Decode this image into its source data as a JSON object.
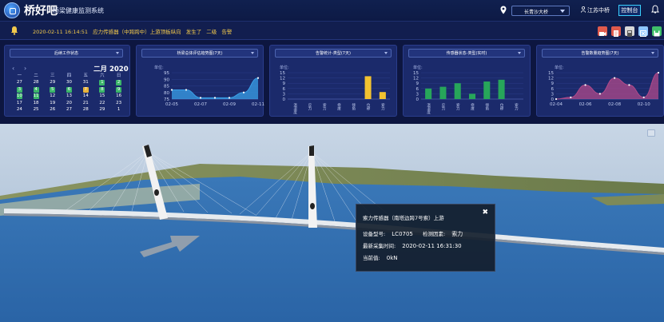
{
  "header": {
    "title": "桥好吧",
    "subtitle": "桥梁健康监测系统",
    "bridge_select": "长青沙大桥",
    "user": "江苏中桥",
    "control_button": "控制台"
  },
  "alert": {
    "datetime": "2020-02-11 16:14:51",
    "message": "应力传感器（中跨跨中）上游顶板纵向",
    "event": "发生了",
    "level": "二级",
    "type": "告警",
    "tool_icons": [
      {
        "name": "camera-icon",
        "color": "#e05a4c"
      },
      {
        "name": "document-icon",
        "color": "#e05a4c"
      },
      {
        "name": "calculator-icon",
        "color": "#d8d8d8"
      },
      {
        "name": "close-box-icon",
        "color": "#8ec6ff"
      },
      {
        "name": "save-icon",
        "color": "#3fbf6a"
      }
    ]
  },
  "calendar": {
    "select": "后续工作状态",
    "title": "二月 2020",
    "weekdays": [
      "一",
      "二",
      "三",
      "四",
      "五",
      "六",
      "日"
    ],
    "days": [
      {
        "d": "27",
        "m": "other",
        "c": null
      },
      {
        "d": "28",
        "m": "other",
        "c": null
      },
      {
        "d": "29",
        "m": "other",
        "c": null
      },
      {
        "d": "30",
        "m": "other",
        "c": null
      },
      {
        "d": "31",
        "m": "other",
        "c": null
      },
      {
        "d": "1",
        "m": "cur",
        "c": "#3bb56a"
      },
      {
        "d": "2",
        "m": "cur",
        "c": "#3bb56a"
      },
      {
        "d": "3",
        "m": "cur",
        "c": "#3bb56a"
      },
      {
        "d": "4",
        "m": "cur",
        "c": "#3bb56a"
      },
      {
        "d": "5",
        "m": "cur",
        "c": "#3bb56a"
      },
      {
        "d": "6",
        "m": "cur",
        "c": "#3bb56a"
      },
      {
        "d": "7",
        "m": "cur",
        "c": "#e8b33a"
      },
      {
        "d": "8",
        "m": "cur",
        "c": "#3bb56a"
      },
      {
        "d": "9",
        "m": "cur",
        "c": "#3bb56a"
      },
      {
        "d": "10",
        "m": "cur",
        "c": "#3bb56a"
      },
      {
        "d": "11",
        "m": "cur",
        "c": "#3bb56a"
      },
      {
        "d": "12",
        "m": "cur",
        "c": null
      },
      {
        "d": "13",
        "m": "cur",
        "c": null
      },
      {
        "d": "14",
        "m": "cur",
        "c": null
      },
      {
        "d": "15",
        "m": "cur",
        "c": null
      },
      {
        "d": "16",
        "m": "cur",
        "c": null
      },
      {
        "d": "17",
        "m": "cur",
        "c": null
      },
      {
        "d": "18",
        "m": "cur",
        "c": null
      },
      {
        "d": "19",
        "m": "cur",
        "c": null
      },
      {
        "d": "20",
        "m": "cur",
        "c": null
      },
      {
        "d": "21",
        "m": "cur",
        "c": null
      },
      {
        "d": "22",
        "m": "cur",
        "c": null
      },
      {
        "d": "23",
        "m": "cur",
        "c": null
      },
      {
        "d": "24",
        "m": "cur",
        "c": null
      },
      {
        "d": "25",
        "m": "cur",
        "c": null
      },
      {
        "d": "26",
        "m": "cur",
        "c": null
      },
      {
        "d": "27",
        "m": "cur",
        "c": null
      },
      {
        "d": "28",
        "m": "cur",
        "c": null
      },
      {
        "d": "29",
        "m": "cur",
        "c": null
      },
      {
        "d": "1",
        "m": "other",
        "c": null
      }
    ]
  },
  "chart_panels": {
    "trend": {
      "select": "桥梁总体评估趋势图(7天)",
      "unit": "单位:"
    },
    "alarm": {
      "select": "告警统计-类型(7天)",
      "unit": "单位:"
    },
    "sensor": {
      "select": "传感器状态-类型(实时)",
      "unit": "单位:"
    },
    "alarm_trend": {
      "select": "告警数量趋势图(7天)",
      "unit": "单位:"
    }
  },
  "chart_data": [
    {
      "type": "area",
      "title": "桥梁总体评估趋势图(7天)",
      "x": [
        "02-05",
        "02-06",
        "02-07",
        "02-08",
        "02-09",
        "02-10",
        "02-11"
      ],
      "x_tick_labels": [
        "02-05",
        "02-07",
        "02-09",
        "02-11"
      ],
      "values": [
        82,
        82,
        76,
        76,
        76,
        80,
        91
      ],
      "ylim": [
        75,
        95
      ],
      "y_ticks": [
        75,
        80,
        85,
        90,
        95
      ],
      "color": "#3aa0e8"
    },
    {
      "type": "bar",
      "title": "告警统计-类型(7天)",
      "categories": [
        "温湿度",
        "应力",
        "索力",
        "挠度",
        "倾角",
        "位移",
        "索力"
      ],
      "values": [
        0,
        0,
        0,
        0,
        0,
        13,
        4
      ],
      "ylim": [
        0,
        15
      ],
      "y_ticks": [
        0,
        3,
        6,
        9,
        12,
        15
      ],
      "color": "#f2c230"
    },
    {
      "type": "bar",
      "title": "传感器状态-类型(实时)",
      "categories": [
        "温湿度",
        "应力",
        "索力",
        "挠度",
        "倾角",
        "位移",
        "索力"
      ],
      "values": [
        6,
        7,
        9,
        3,
        10,
        11
      ],
      "ylim": [
        0,
        15
      ],
      "y_ticks": [
        0,
        3,
        6,
        9,
        12,
        15
      ],
      "color": "#27a65a"
    },
    {
      "type": "area",
      "title": "告警数量趋势图(7天)",
      "x": [
        "02-04",
        "02-05",
        "02-06",
        "02-07",
        "02-08",
        "02-09",
        "02-10",
        "02-11"
      ],
      "x_tick_labels": [
        "02-04",
        "02-06",
        "02-08",
        "02-10"
      ],
      "values": [
        0,
        1,
        8,
        3,
        12,
        8,
        1,
        15
      ],
      "ylim": [
        0,
        15
      ],
      "y_ticks": [
        0,
        3,
        6,
        9,
        12,
        15
      ],
      "color": "#b04a8a"
    }
  ],
  "popup": {
    "title": "索力传感器（南塔边跨7号索）上游",
    "model_label": "设备型号:",
    "model_value": "LC0705",
    "param_label": "检测因素:",
    "param_value": "索力",
    "time_label": "最新采集时间:",
    "time_value": "2020-02-11 16:31:30",
    "current_label": "当前值:",
    "current_value": "0kN"
  }
}
